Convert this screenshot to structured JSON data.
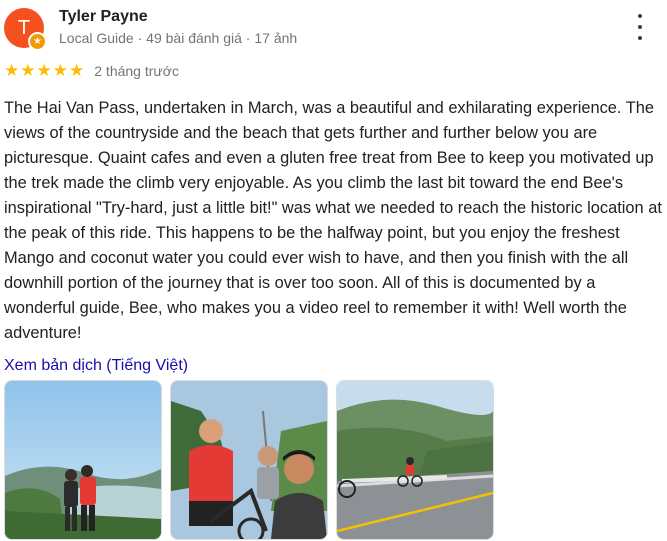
{
  "reviewer": {
    "initial": "T",
    "name": "Tyler Payne",
    "meta": "Local Guide · 49 bài đánh giá · 17 ảnh",
    "avatar_color": "#f4511e",
    "badge_color": "#f29900"
  },
  "rating": {
    "stars": 5,
    "star_color": "#fbbc04",
    "time": "2 tháng trước"
  },
  "review_text": "The Hai Van Pass, undertaken in March, was a beautiful and exhilarating experience. The views of the countryside and the beach that gets further and further below you are picturesque. Quaint cafes and even a gluten free treat from Bee to keep you motivated up the trek made the climb very enjoyable. As you climb the last bit toward the end Bee's inspirational \"Try-hard, just a little bit!\" was what we needed to reach the historic location at the peak of this ride. This happens to be the halfway point, but you enjoy the freshest Mango and coconut water you could ever wish to have, and then you finish with the all downhill portion of the journey that is over too soon. All of this is documented by a wonderful guide, Bee, who makes you a video reel to remember it with! Well worth the adventure!",
  "translate_link": "Xem bản dịch (Tiếng Việt)",
  "link_color": "#1a0dab",
  "more_options_icon": "more-vert-icon",
  "photos": [
    {
      "id": "photo-1",
      "desc": "two-cyclists-coastal-view"
    },
    {
      "id": "photo-2",
      "desc": "selfie-cyclists"
    },
    {
      "id": "photo-3",
      "desc": "mountain-road-cyclist"
    }
  ]
}
